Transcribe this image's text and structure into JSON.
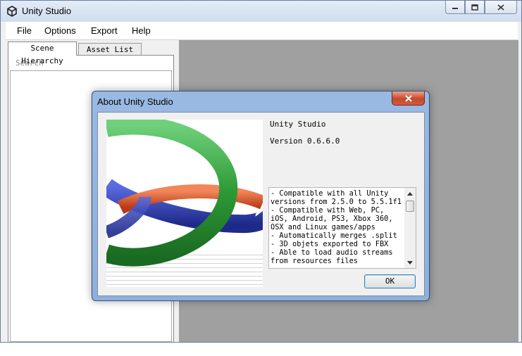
{
  "window": {
    "title": "Unity Studio",
    "icon": "unity-logo-icon",
    "controls": [
      "minimize-icon",
      "maximize-icon",
      "close-icon"
    ]
  },
  "menu": {
    "items": [
      "File",
      "Options",
      "Export",
      "Help"
    ]
  },
  "left_panel": {
    "tabs": [
      {
        "label": "Scene Hierarchy",
        "active": true
      },
      {
        "label": "Asset List",
        "active": false
      }
    ],
    "search": {
      "placeholder": "Search"
    }
  },
  "dialog": {
    "title": "About Unity Studio",
    "program_name": "Unity Studio",
    "version": "Version 0.6.6.0",
    "features": "- Compatible with all Unity versions from 2.5.0 to 5.5.1f1\n- Compatible with Web, PC, iOS, Android, PS3, Xbox 360, OSX and Linux games/apps\n- Automatically merges .split\n- 3D objets exported to FBX\n- Able to load audio streams from resources files",
    "ok_label": "OK"
  },
  "colors": {
    "preview_bg": "#a0a0a0",
    "dialog_frame": "#8fb0dc",
    "close_red": "#c8472d",
    "logo_green": "#2d9a36",
    "logo_blue": "#2e3fb0",
    "logo_orange": "#e0572c"
  }
}
